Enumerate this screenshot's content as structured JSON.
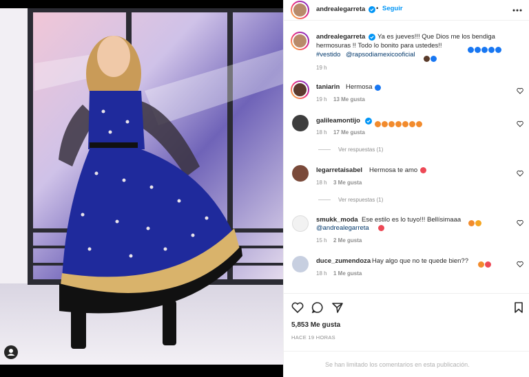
{
  "post": {
    "username": "andrealegarreta",
    "follow_label": "Seguir",
    "caption_line1": "Ya es jueves!!! Que Dios me los bendiga",
    "caption_line2": "hermosuras !! Todo lo bonito para ustedes!!",
    "hashtag": "#vestido",
    "mention": "@rapsodiamexicooficial",
    "time": "19 h",
    "likes": "5,853 Me gusta",
    "posted_ago": "HACE 19 HORAS",
    "limited_notice": "Se han limitado los comentarios en esta publicación."
  },
  "comments": [
    {
      "username": "taniarin",
      "text": "Hermosa",
      "time": "19 h",
      "likes": "13 Me gusta",
      "verified": false
    },
    {
      "username": "galileamontijo",
      "text": "",
      "time": "18 h",
      "likes": "17 Me gusta",
      "verified": true,
      "replies": "Ver respuestas (1)"
    },
    {
      "username": "legarretaisabel",
      "text": "Hermosa te amo",
      "time": "18 h",
      "likes": "3 Me gusta",
      "verified": false,
      "replies": "Ver respuestas (1)"
    },
    {
      "username": "smukk_moda",
      "text": "Ese estilo es lo tuyo!!! Bellísimaaa",
      "mention": "@andrealegarreta",
      "time": "15 h",
      "likes": "2 Me gusta",
      "verified": false
    },
    {
      "username": "duce_zumendoza",
      "text": "Hay algo que no te quede bien??",
      "time": "18 h",
      "likes": "1 Me gusta",
      "verified": false
    }
  ],
  "colors": {
    "accent": "#0095f6",
    "heart": "#ed4956",
    "blue_heart": "#1877f2",
    "dress": "#1f2a9c"
  },
  "icons": [
    "more-icon",
    "heart-icon",
    "comment-icon",
    "share-icon",
    "bookmark-icon",
    "verified-icon",
    "user-tag-icon"
  ]
}
